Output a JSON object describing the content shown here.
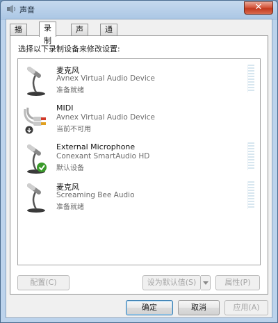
{
  "window": {
    "title": "声音",
    "close_label": "✕"
  },
  "tabs": [
    {
      "label": "播放",
      "active": false
    },
    {
      "label": "录制",
      "active": true
    },
    {
      "label": "声音",
      "active": false
    },
    {
      "label": "通信",
      "active": false
    }
  ],
  "panel": {
    "instruction": "选择以下录制设备来修改设置:"
  },
  "devices": [
    {
      "name": "麦克风",
      "description": "Avnex Virtual Audio Device",
      "status": "准备就绪",
      "icon": "microphone-icon",
      "has_meter": true,
      "badge": ""
    },
    {
      "name": "MIDI",
      "description": "Avnex Virtual Audio Device",
      "status": "当前不可用",
      "icon": "rca-cable-icon",
      "has_meter": false,
      "badge": "down-arrow-badge-icon"
    },
    {
      "name": "External Microphone",
      "description": "Conexant SmartAudio HD",
      "status": "默认设备",
      "icon": "microphone-icon",
      "has_meter": true,
      "badge": "default-check-badge-icon"
    },
    {
      "name": "麦克风",
      "description": "Screaming Bee Audio",
      "status": "准备就绪",
      "icon": "microphone-icon",
      "has_meter": true,
      "badge": ""
    }
  ],
  "buttons": {
    "configure": "配置(C)",
    "set_default": "设为默认值(S)",
    "properties": "属性(P)",
    "ok": "确定",
    "cancel": "取消",
    "apply": "应用(A)"
  },
  "colors": {
    "default_check": "#3a9a2a",
    "meter": "#d7e6ef"
  }
}
